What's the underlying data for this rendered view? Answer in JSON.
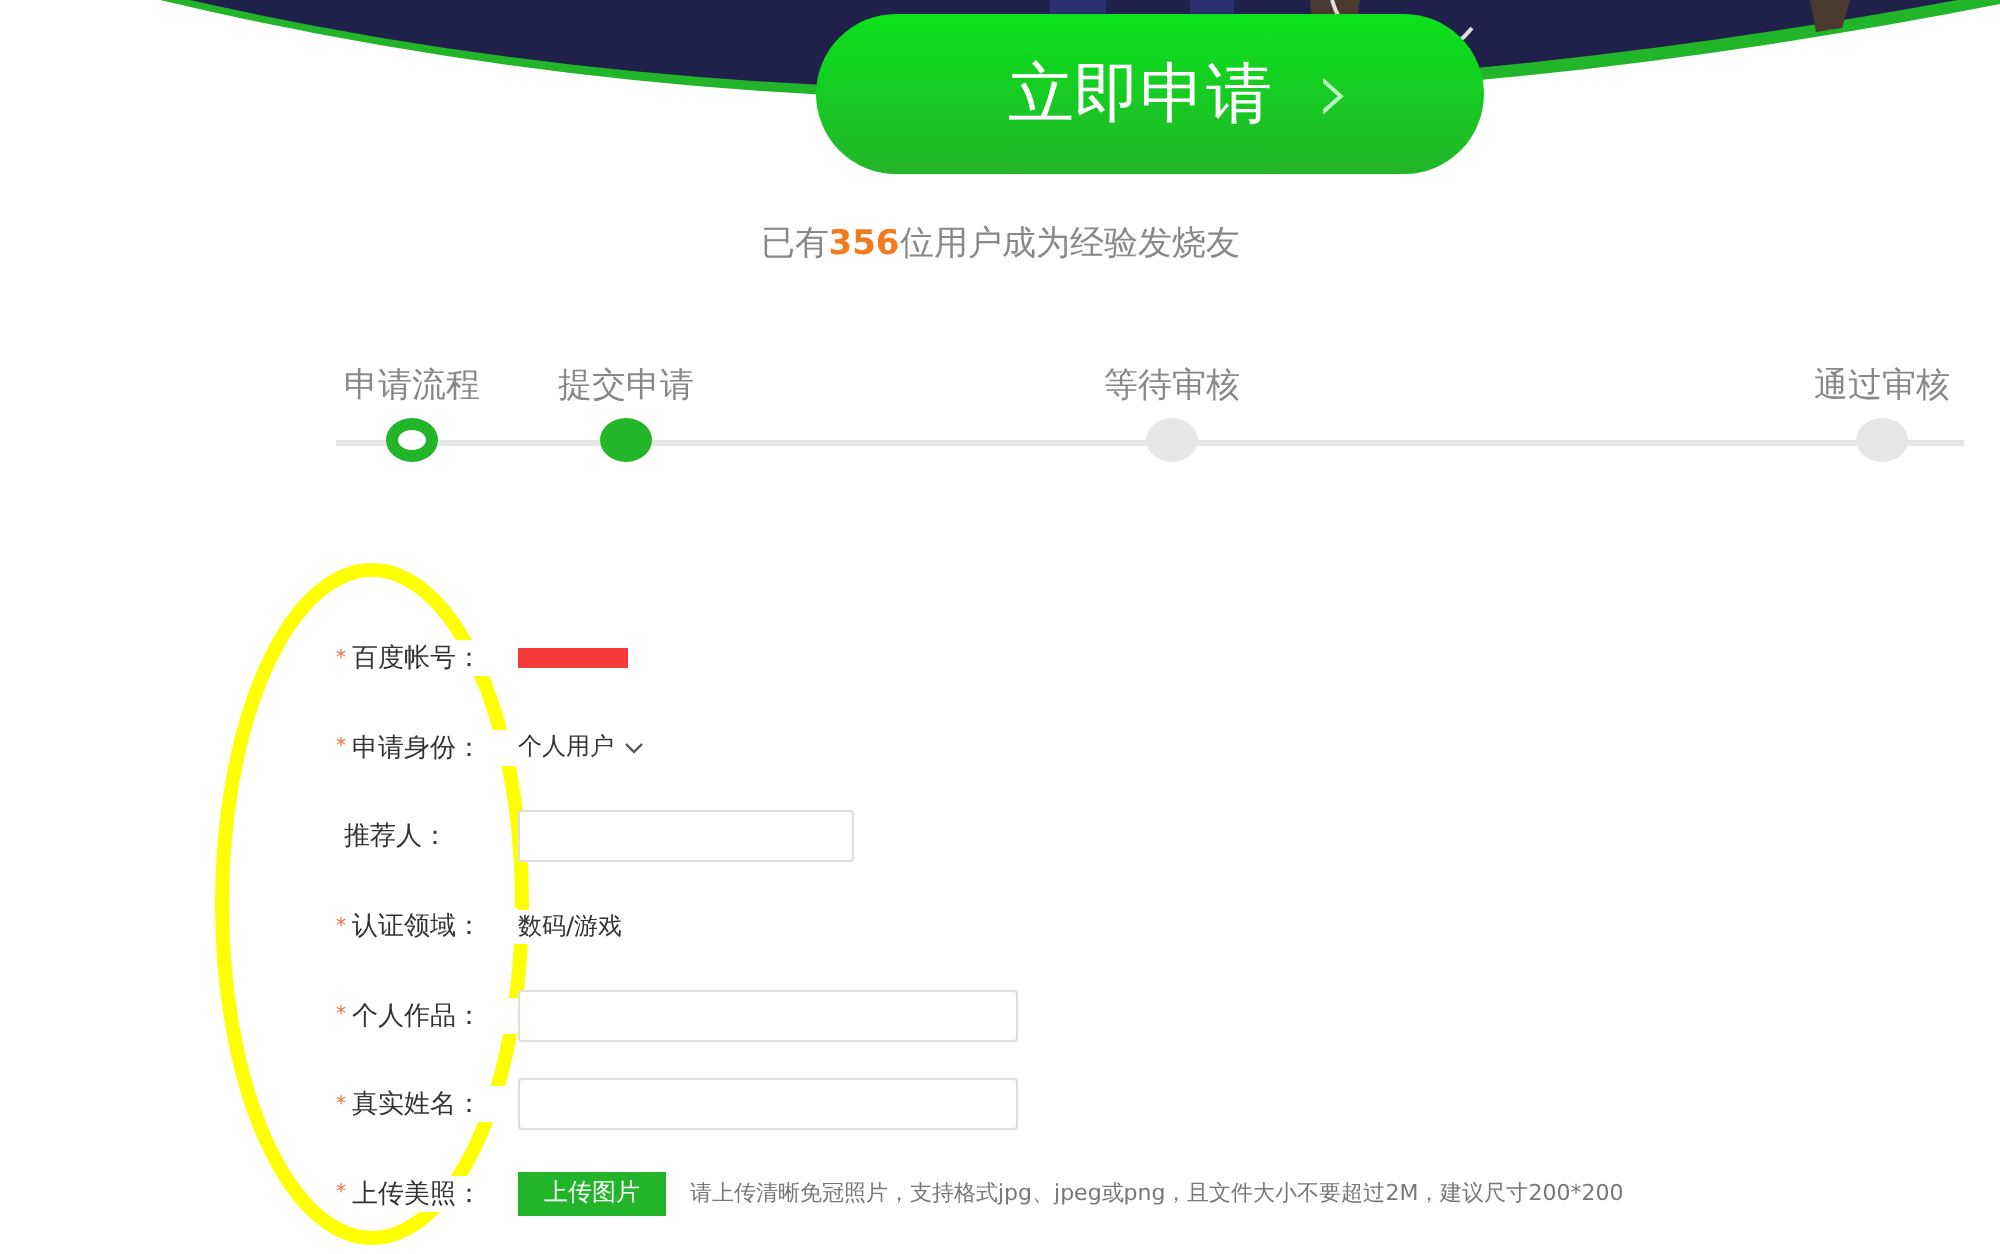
{
  "apply_button": {
    "label": "立即申请",
    "arrow": "›"
  },
  "member_count": {
    "prefix": "已有",
    "count": "356",
    "suffix": "位用户成为经验发烧友"
  },
  "steps": [
    {
      "label": "申请流程",
      "kind": "ring"
    },
    {
      "label": "提交申请",
      "kind": "filled"
    },
    {
      "label": "等待审核",
      "kind": "empty"
    },
    {
      "label": "通过审核",
      "kind": "empty"
    }
  ],
  "form": {
    "fields": [
      {
        "label": "百度帐号：",
        "mark": "*",
        "kind": "redacted"
      },
      {
        "label": "申请身份：",
        "mark": "*",
        "kind": "select",
        "value": "个人用户"
      },
      {
        "label": "推荐人：",
        "kind": "input"
      },
      {
        "label": "认证领域：",
        "mark": "*",
        "kind": "text",
        "value": "数码/游戏"
      },
      {
        "label": "个人作品：",
        "mark": "*",
        "kind": "input"
      },
      {
        "label": "真实姓名：",
        "mark": "*",
        "kind": "input"
      },
      {
        "label": "上传美照：",
        "mark": "*",
        "kind": "upload",
        "button": "上传图片",
        "hint": "请上传清晰免冠照片，支持格式jpg、jpeg或png，且文件大小不要超过2M，建议尺寸200*200"
      }
    ]
  },
  "annotation": {
    "kind": "ellipse"
  }
}
